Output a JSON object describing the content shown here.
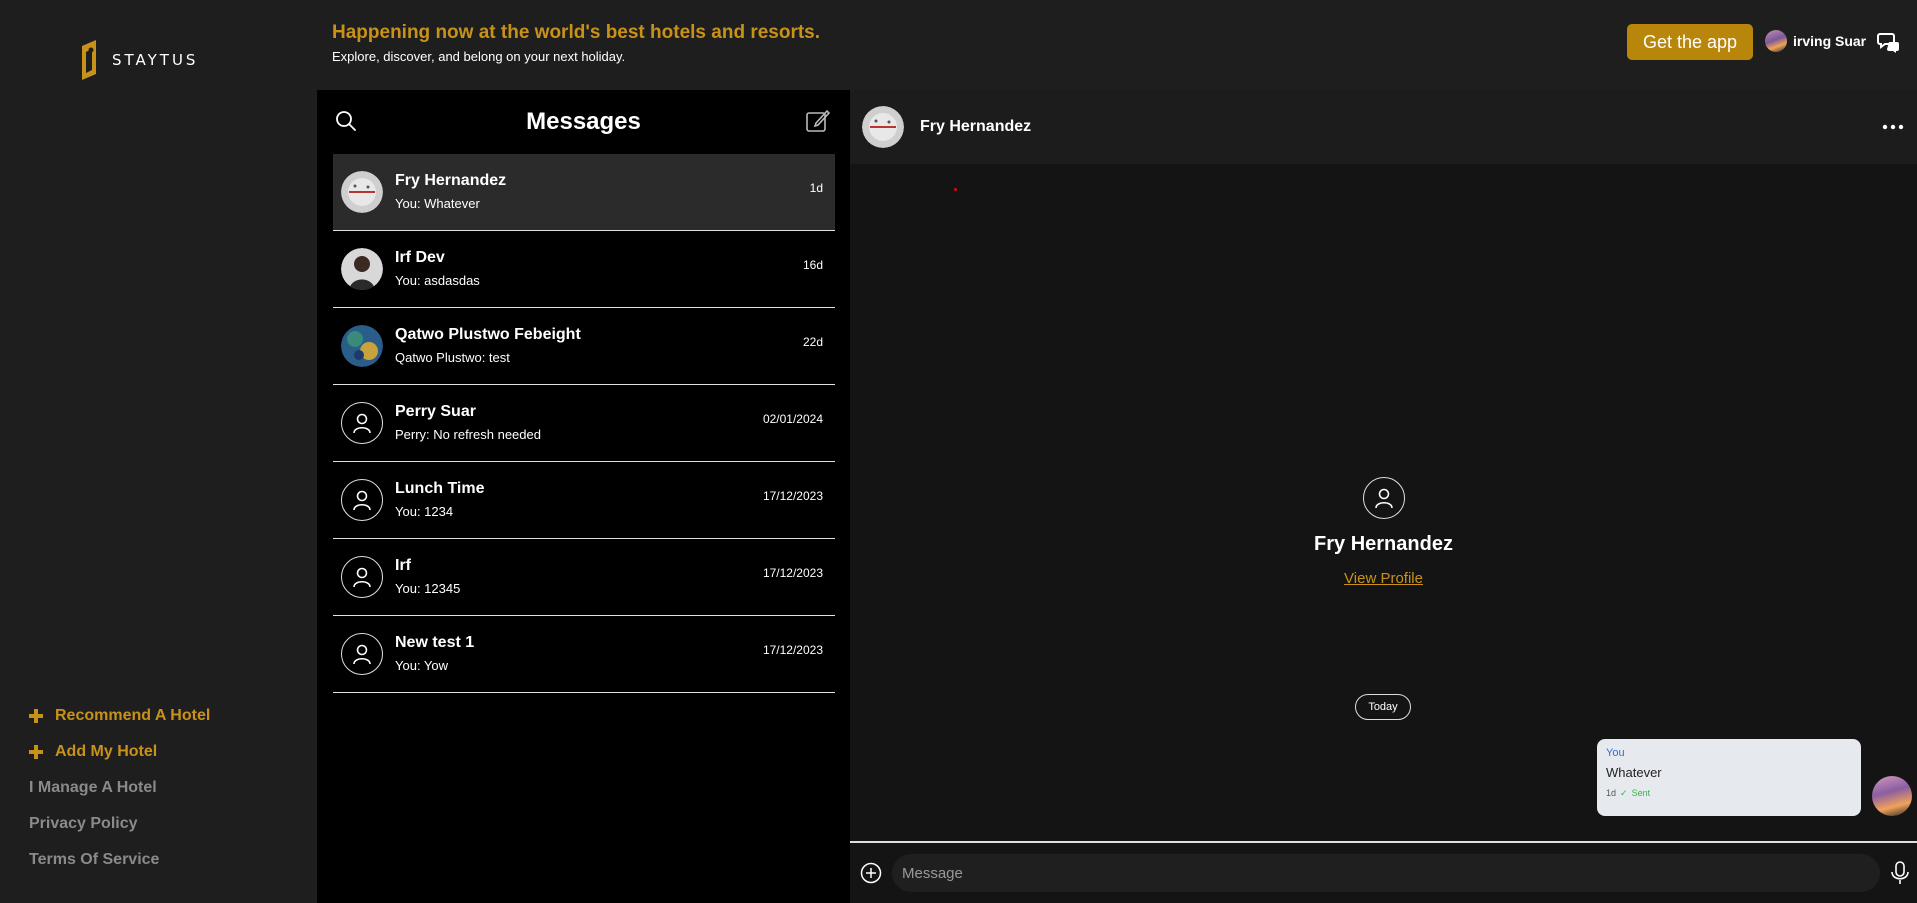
{
  "brand": {
    "name": "STAYTUS",
    "logo_icon": "staytus-logo-icon"
  },
  "sidebar": {
    "links": [
      {
        "label": "Recommend A Hotel",
        "icon": "plus-icon",
        "accent": true
      },
      {
        "label": "Add My Hotel",
        "icon": "plus-icon",
        "accent": true
      },
      {
        "label": "I Manage A Hotel",
        "accent": false
      },
      {
        "label": "Privacy Policy",
        "accent": false
      },
      {
        "label": "Terms Of Service",
        "accent": false
      }
    ]
  },
  "header": {
    "title": "Happening now at the world's best hotels and resorts.",
    "subtitle": "Explore, discover, and belong on your next holiday.",
    "cta_label": "Get the app",
    "user_name": "irving Suar",
    "chat_icon": "chat-bubbles-icon"
  },
  "messages": {
    "title": "Messages",
    "conversations": [
      {
        "name": "Fry Hernandez",
        "preview": "You: Whatever",
        "time": "1d",
        "avatar": "photo",
        "active": true
      },
      {
        "name": "Irf Dev",
        "preview": "You: asdasdas",
        "time": "16d",
        "avatar": "photo",
        "active": false
      },
      {
        "name": "Qatwo Plustwo Febeight",
        "preview": "Qatwo Plustwo: test",
        "time": "22d",
        "avatar": "photo",
        "active": false
      },
      {
        "name": "Perry Suar",
        "preview": "Perry: No refresh needed",
        "time": "02/01/2024",
        "avatar": "default",
        "active": false
      },
      {
        "name": "Lunch Time",
        "preview": "You: 1234",
        "time": "17/12/2023",
        "avatar": "default",
        "active": false
      },
      {
        "name": "Irf",
        "preview": "You: 12345",
        "time": "17/12/2023",
        "avatar": "default",
        "active": false
      },
      {
        "name": "New test 1",
        "preview": "You: Yow",
        "time": "17/12/2023",
        "avatar": "default",
        "active": false
      }
    ]
  },
  "chat": {
    "contact_name": "Fry Hernandez",
    "profile_name": "Fry Hernandez",
    "view_profile": "View Profile",
    "day_label": "Today",
    "bubble": {
      "sender": "You",
      "text": "Whatever",
      "time": "1d",
      "status": "Sent"
    },
    "input_placeholder": "Message"
  },
  "colors": {
    "accent": "#c8921a",
    "button": "#b8860b",
    "sidebar_bg": "#1e1e1e",
    "chat_bg": "#141414",
    "sent_status": "#3cb043",
    "sender_label": "#2f6fd0"
  }
}
